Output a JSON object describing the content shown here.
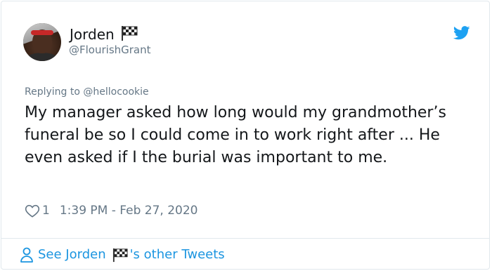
{
  "tweet": {
    "author": {
      "name": "Jorden",
      "name_emoji": "checkered-flag-icon",
      "handle": "@FlourishGrant"
    },
    "reply_prefix": "Replying to ",
    "reply_to": "@hellocookie",
    "text": "My manager asked how long would my grandmother’s funeral be so I could come in to work right after ... He even asked if I the burial was important to me.",
    "likes": "1",
    "timestamp": "1:39 PM - Feb 27, 2020",
    "see_more_prefix": "See Jorden",
    "see_more_suffix": "'s other Tweets"
  },
  "icons": {
    "platform": "twitter-bird-icon",
    "like": "heart-outline-icon",
    "profile": "person-outline-icon"
  },
  "colors": {
    "link": "#1b95e0",
    "secondary_text": "#657786",
    "primary_text": "#14171a",
    "border": "#e1e8ed"
  }
}
